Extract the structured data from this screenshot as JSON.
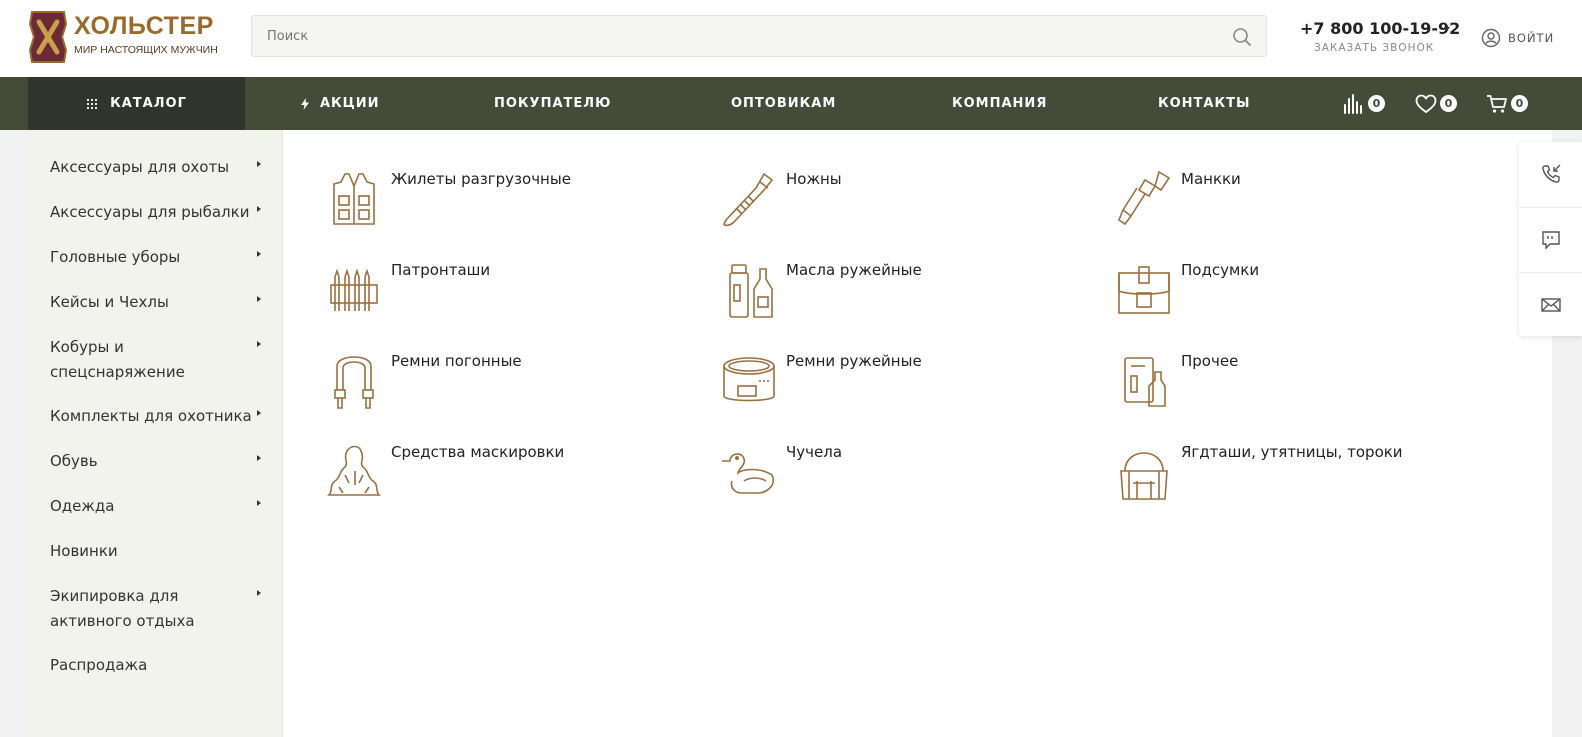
{
  "header": {
    "logo": {
      "title": "ХОЛЬСТЕР",
      "subtitle": "МИР НАСТОЯЩИХ МУЖЧИН",
      "emblem_letter": "Х"
    },
    "search": {
      "placeholder": "Поиск",
      "value": ""
    },
    "phone": "+7 800 100-19-92",
    "callback_label": "ЗАКАЗАТЬ ЗВОНОК",
    "login_label": "ВОЙТИ"
  },
  "nav": {
    "catalog": "КАТАЛОГ",
    "items": [
      "АКЦИИ",
      "ПОКУПАТЕЛЮ",
      "ОПТОВИКАМ",
      "КОМПАНИЯ",
      "КОНТАКТЫ"
    ],
    "compare_count": "0",
    "favorites_count": "0",
    "cart_count": "0"
  },
  "sidebar": {
    "items": [
      {
        "label": "Аксессуары для охоты",
        "has_children": true
      },
      {
        "label": "Аксессуары для рыбалки",
        "has_children": true
      },
      {
        "label": "Головные уборы",
        "has_children": true
      },
      {
        "label": "Кейсы и Чехлы",
        "has_children": true
      },
      {
        "label": "Кобуры и спецснаряжение",
        "has_children": true
      },
      {
        "label": "Комплекты для охотника",
        "has_children": true
      },
      {
        "label": "Обувь",
        "has_children": true
      },
      {
        "label": "Одежда",
        "has_children": true
      },
      {
        "label": "Новинки",
        "has_children": false
      },
      {
        "label": "Экипировка для активного отдыха",
        "has_children": true
      },
      {
        "label": "Распродажа",
        "has_children": false
      }
    ]
  },
  "categories": [
    {
      "label": "Жилеты разгрузочные",
      "icon": "vest-icon"
    },
    {
      "label": "Ножны",
      "icon": "knife-sheath-icon"
    },
    {
      "label": "Манкки",
      "icon": "game-call-icon"
    },
    {
      "label": "Патронташи",
      "icon": "cartridge-belt-icon"
    },
    {
      "label": "Масла ружейные",
      "icon": "gun-oil-icon"
    },
    {
      "label": "Подсумки",
      "icon": "pouch-icon"
    },
    {
      "label": "Ремни погонные",
      "icon": "sling-icon"
    },
    {
      "label": "Ремни ружейные",
      "icon": "rifle-belt-icon"
    },
    {
      "label": "Прочее",
      "icon": "misc-icon"
    },
    {
      "label": "Средства маскировки",
      "icon": "camouflage-icon"
    },
    {
      "label": "Чучела",
      "icon": "duck-decoy-icon"
    },
    {
      "label": "Ягдташи, утятницы, тороки",
      "icon": "game-bag-icon"
    }
  ],
  "floating_actions": [
    "callback-icon",
    "chat-icon",
    "mail-icon"
  ],
  "colors": {
    "nav_bg": "#454b39",
    "nav_active": "#30342a",
    "accent": "#9a6a2c",
    "icon_stroke": "#9a7040"
  }
}
